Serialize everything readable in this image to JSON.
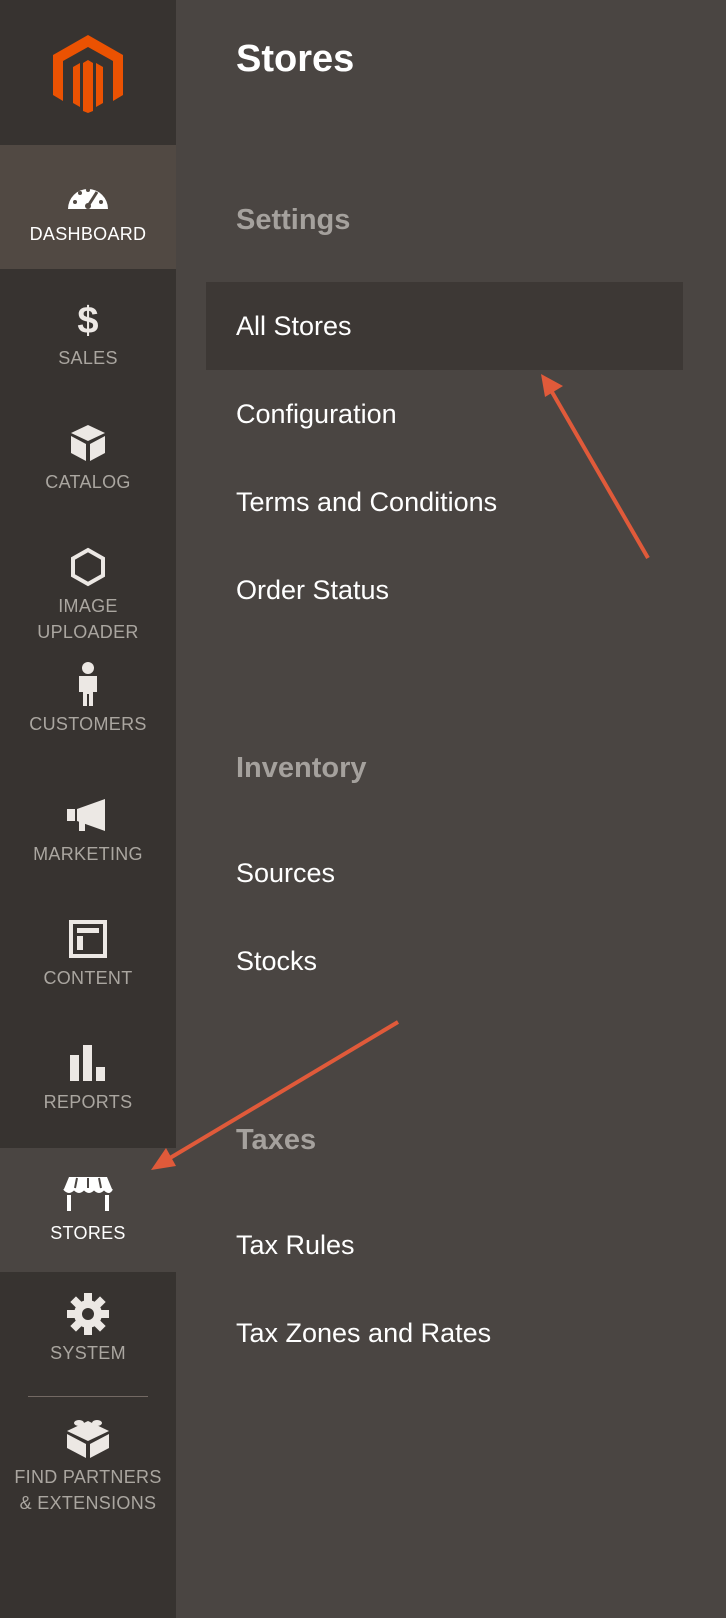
{
  "sidebar": {
    "logo_name": "magento-logo",
    "items": [
      {
        "label": "DASHBOARD",
        "icon": "dashboard-icon",
        "state": "active"
      },
      {
        "label": "SALES",
        "icon": "dollar-icon",
        "state": ""
      },
      {
        "label": "CATALOG",
        "icon": "box-icon",
        "state": ""
      },
      {
        "label": "IMAGE\nUPLOADER",
        "label_line1": "IMAGE",
        "label_line2": "UPLOADER",
        "icon": "hexagon-icon",
        "state": ""
      },
      {
        "label": "CUSTOMERS",
        "icon": "person-icon",
        "state": ""
      },
      {
        "label": "MARKETING",
        "icon": "megaphone-icon",
        "state": ""
      },
      {
        "label": "CONTENT",
        "icon": "layout-icon",
        "state": ""
      },
      {
        "label": "REPORTS",
        "icon": "bar-chart-icon",
        "state": ""
      },
      {
        "label": "STORES",
        "icon": "storefront-icon",
        "state": "current"
      },
      {
        "label": "SYSTEM",
        "icon": "gear-icon",
        "state": ""
      },
      {
        "label": "FIND PARTNERS & EXTENSIONS",
        "label_line1": "FIND PARTNERS",
        "label_line2": "& EXTENSIONS",
        "icon": "blocks-icon",
        "state": ""
      }
    ]
  },
  "panel": {
    "title": "Stores",
    "sections": [
      {
        "title": "Settings",
        "links": [
          "All Stores",
          "Configuration",
          "Terms and Conditions",
          "Order Status"
        ]
      },
      {
        "title": "Inventory",
        "links": [
          "Sources",
          "Stocks"
        ]
      },
      {
        "title": "Taxes",
        "links": [
          "Tax Rules",
          "Tax Zones and Rates"
        ]
      }
    ],
    "highlighted_link": "All Stores"
  },
  "colors": {
    "brand": "#eb5202",
    "sidebar_bg": "#373330",
    "panel_bg": "#4a4542",
    "annotation_arrow": "#e05a3a"
  }
}
